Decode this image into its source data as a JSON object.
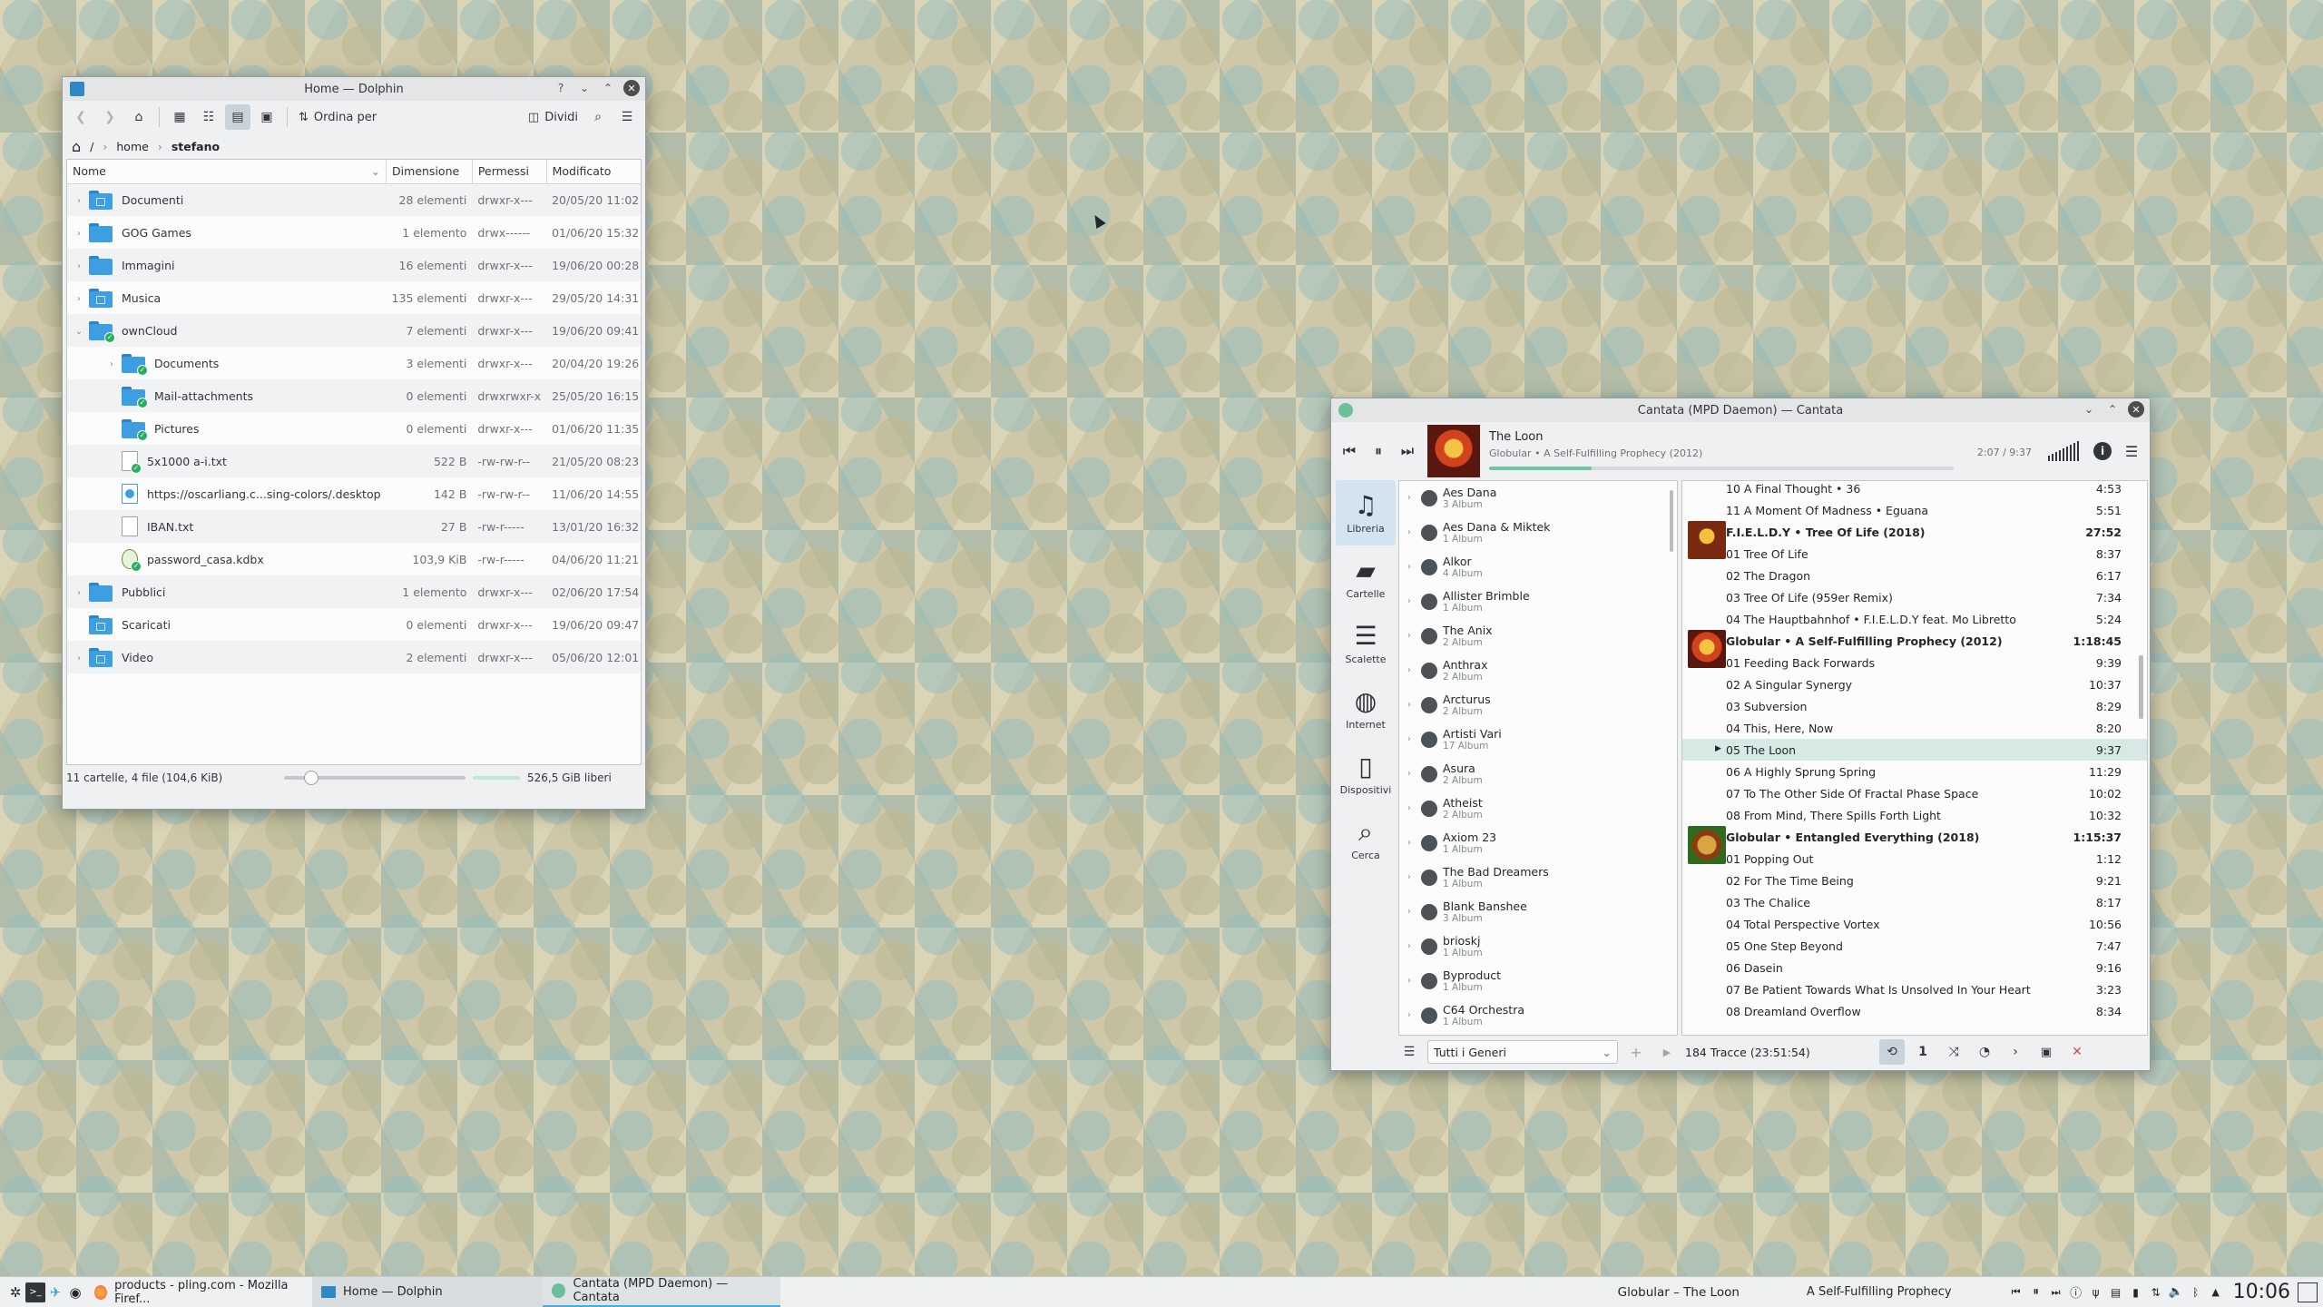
{
  "dolphin": {
    "title": "Home — Dolphin",
    "toolbar": {
      "sort_label": "Ordina per",
      "split_label": "Dividi"
    },
    "breadcrumb": {
      "root": "/",
      "home": "home",
      "user": "stefano"
    },
    "columns": {
      "name": "Nome",
      "size": "Dimensione",
      "perms": "Permessi",
      "modified": "Modificato"
    },
    "rows": [
      {
        "name": "Documenti",
        "size": "28 elementi",
        "perms": "drwxr-x---",
        "modified": "20/05/20 11:02"
      },
      {
        "name": "GOG Games",
        "size": "1 elemento",
        "perms": "drwx------",
        "modified": "01/06/20 15:32"
      },
      {
        "name": "Immagini",
        "size": "16 elementi",
        "perms": "drwxr-x---",
        "modified": "19/06/20 00:28"
      },
      {
        "name": "Musica",
        "size": "135 elementi",
        "perms": "drwxr-x---",
        "modified": "29/05/20 14:31"
      },
      {
        "name": "ownCloud",
        "size": "7 elementi",
        "perms": "drwxr-x---",
        "modified": "19/06/20 09:41"
      },
      {
        "name": "Documents",
        "size": "3 elementi",
        "perms": "drwxr-x---",
        "modified": "20/04/20 19:26"
      },
      {
        "name": "Mail-attachments",
        "size": "0 elementi",
        "perms": "drwxrwxr-x",
        "modified": "25/05/20 16:15"
      },
      {
        "name": "Pictures",
        "size": "0 elementi",
        "perms": "drwxr-x---",
        "modified": "01/06/20 11:35"
      },
      {
        "name": "5x1000 a-i.txt",
        "size": "522 B",
        "perms": "-rw-rw-r--",
        "modified": "21/05/20 08:23"
      },
      {
        "name": "https://oscarliang.c...sing-colors/.desktop",
        "size": "142 B",
        "perms": "-rw-rw-r--",
        "modified": "11/06/20 14:55"
      },
      {
        "name": "IBAN.txt",
        "size": "27 B",
        "perms": "-rw-r-----",
        "modified": "13/01/20 16:32"
      },
      {
        "name": "password_casa.kdbx",
        "size": "103,9 KiB",
        "perms": "-rw-r-----",
        "modified": "04/06/20 11:21"
      },
      {
        "name": "Pubblici",
        "size": "1 elemento",
        "perms": "drwxr-x---",
        "modified": "02/06/20 17:54"
      },
      {
        "name": "Scaricati",
        "size": "0 elementi",
        "perms": "drwxr-x---",
        "modified": "19/06/20 09:47"
      },
      {
        "name": "Video",
        "size": "2 elementi",
        "perms": "drwxr-x---",
        "modified": "05/06/20 12:01"
      }
    ],
    "status": {
      "summary": "11 cartelle, 4 file (104,6 KiB)",
      "free": "526,5 GiB liberi"
    }
  },
  "cantata": {
    "title": "Cantata (MPD Daemon) — Cantata",
    "now_playing": {
      "track": "The Loon",
      "details": "Globular • A Self-Fulfilling Prophecy (2012)",
      "time": "2:07 / 9:37",
      "progress": 0.22
    },
    "sidebar": [
      {
        "label": "Libreria",
        "icon": "music-note-icon"
      },
      {
        "label": "Cartelle",
        "icon": "folder-icon"
      },
      {
        "label": "Scalette",
        "icon": "list-icon"
      },
      {
        "label": "Internet",
        "icon": "globe-icon"
      },
      {
        "label": "Dispositivi",
        "icon": "phone-icon"
      },
      {
        "label": "Cerca",
        "icon": "search-icon"
      }
    ],
    "artists": [
      {
        "name": "Aes Dana",
        "sub": "3 Album"
      },
      {
        "name": "Aes Dana & Miktek",
        "sub": "1 Album"
      },
      {
        "name": "Alkor",
        "sub": "4 Album"
      },
      {
        "name": "Allister Brimble",
        "sub": "1 Album"
      },
      {
        "name": "The Anix",
        "sub": "2 Album"
      },
      {
        "name": "Anthrax",
        "sub": "2 Album"
      },
      {
        "name": "Arcturus",
        "sub": "2 Album"
      },
      {
        "name": "Artisti Vari",
        "sub": "17 Album"
      },
      {
        "name": "Asura",
        "sub": "2 Album"
      },
      {
        "name": "Atheist",
        "sub": "2 Album"
      },
      {
        "name": "Axiom 23",
        "sub": "1 Album"
      },
      {
        "name": "The Bad Dreamers",
        "sub": "1 Album"
      },
      {
        "name": "Blank Banshee",
        "sub": "3 Album"
      },
      {
        "name": "brioskj",
        "sub": "1 Album"
      },
      {
        "name": "Byproduct",
        "sub": "1 Album"
      },
      {
        "name": "C64 Orchestra",
        "sub": "1 Album"
      }
    ],
    "playlist": [
      {
        "title": "10 A Final Thought • 36",
        "dur": "4:53"
      },
      {
        "title": "11 A Moment Of Madness • Eguana",
        "dur": "5:51"
      },
      {
        "title": "F.I.E.L.D.Y • Tree Of Life (2018)",
        "dur": "27:52",
        "header": true
      },
      {
        "title": "01 Tree Of Life",
        "dur": "8:37"
      },
      {
        "title": "02 The Dragon",
        "dur": "6:17"
      },
      {
        "title": "03 Tree Of Life (959er Remix)",
        "dur": "7:34"
      },
      {
        "title": "04 The Hauptbahnhof • F.I.E.L.D.Y feat. Mo Libretto",
        "dur": "5:24"
      },
      {
        "title": "Globular • A Self-Fulfilling Prophecy (2012)",
        "dur": "1:18:45",
        "header": true
      },
      {
        "title": "01 Feeding Back Forwards",
        "dur": "9:39"
      },
      {
        "title": "02 A Singular Synergy",
        "dur": "10:37"
      },
      {
        "title": "03 Subversion",
        "dur": "8:29"
      },
      {
        "title": "04 This, Here, Now",
        "dur": "8:20"
      },
      {
        "title": "05 The Loon",
        "dur": "9:37",
        "current": true
      },
      {
        "title": "06 A Highly Sprung Spring",
        "dur": "11:29"
      },
      {
        "title": "07 To The Other Side Of Fractal Phase Space",
        "dur": "10:02"
      },
      {
        "title": "08 From Mind, There Spills Forth Light",
        "dur": "10:32"
      },
      {
        "title": "Globular • Entangled Everything (2018)",
        "dur": "1:15:37",
        "header": true
      },
      {
        "title": "01 Popping Out",
        "dur": "1:12"
      },
      {
        "title": "02 For The Time Being",
        "dur": "9:21"
      },
      {
        "title": "03 The Chalice",
        "dur": "8:17"
      },
      {
        "title": "04 Total Perspective Vortex",
        "dur": "10:56"
      },
      {
        "title": "05 One Step Beyond",
        "dur": "7:47"
      },
      {
        "title": "06 Dasein",
        "dur": "9:16"
      },
      {
        "title": "07 Be Patient Towards What Is Unsolved In Your Heart",
        "dur": "3:23"
      },
      {
        "title": "08 Dreamland Overflow",
        "dur": "8:34"
      }
    ],
    "genre_select": "Tutti i Generi",
    "tracks_summary": "184 Tracce (23:51:54)"
  },
  "taskbar": {
    "tasks": [
      {
        "label": "products - pling.com - Mozilla Firef..."
      },
      {
        "label": "Home — Dolphin"
      },
      {
        "label": "Cantata (MPD Daemon) — Cantata"
      }
    ],
    "media_title": "Globular – The Loon",
    "media_album": "A Self-Fulfilling Prophecy",
    "clock": "10:06"
  },
  "colors": {
    "accent": "#3daee9",
    "folder": "#3d9ee1",
    "synced": "#27ae60"
  }
}
